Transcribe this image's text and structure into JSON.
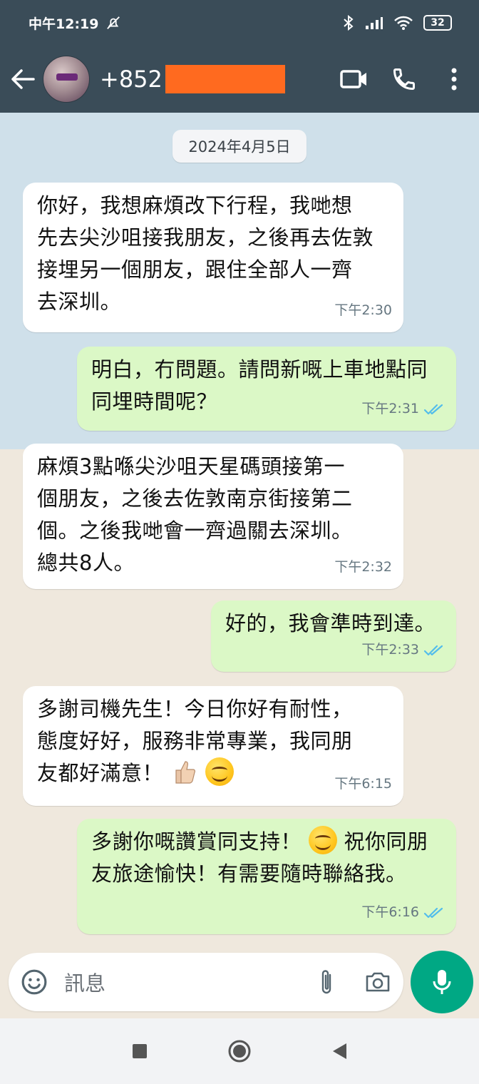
{
  "status_bar": {
    "time": "中午12:19",
    "battery": "32"
  },
  "header": {
    "contact_name": "+852"
  },
  "chat": {
    "date_chip": "2024年4月5日",
    "messages": [
      {
        "direction": "incoming",
        "lines": [
          "你好，我想麻煩改下行程，我哋想",
          "先去尖沙咀接我朋友，之後再去佐敦",
          "接埋另一個朋友，跟住全部人一齊",
          "去深圳。"
        ],
        "time": "下午2:30"
      },
      {
        "direction": "outgoing",
        "lines": [
          "明白，冇問題。請問新嘅上車地點同",
          "同埋時間呢？"
        ],
        "time": "下午2:31"
      },
      {
        "direction": "incoming",
        "lines": [
          "麻煩3點喺尖沙咀天星碼頭接第一",
          "個朋友，之後去佐敦南京街接第二",
          "個。之後我哋會一齊過關去深圳。",
          "總共8人。"
        ],
        "time": "下午2:32"
      },
      {
        "direction": "outgoing",
        "lines": [
          "好的，我會準時到達。"
        ],
        "time": "下午2:33"
      },
      {
        "direction": "incoming",
        "lines": [
          "多謝司機先生！今日你好有耐性，",
          "態度好好，服務非常專業，我同朋",
          "友都好滿意！"
        ],
        "time": "下午6:15"
      },
      {
        "direction": "outgoing",
        "lines": [
          "多謝你嘅讚賞同支持！",
          " 祝你同朋",
          "友旅途愉快！有需要隨時聯絡我。"
        ],
        "time": "下午6:16"
      }
    ]
  },
  "composer": {
    "placeholder": "訊息"
  },
  "icons": {
    "mute": "mute-icon",
    "bluetooth": "bluetooth-icon",
    "signal": "signal-icon",
    "wifi": "wifi-icon",
    "back": "back-arrow-icon",
    "video": "video-call-icon",
    "phone": "phone-call-icon",
    "more": "more-vertical-icon",
    "read_receipt": "double-check-icon",
    "emoji": "emoji-icon",
    "attach": "paperclip-icon",
    "camera": "camera-icon",
    "mic": "microphone-icon"
  },
  "colors": {
    "header": "#3a4c58",
    "outgoing_bubble": "#dbf8c6",
    "incoming_bubble": "#ffffff",
    "read_receipt": "#53bdeb",
    "mic_button": "#00a884",
    "redaction": "#ff6a1f"
  }
}
